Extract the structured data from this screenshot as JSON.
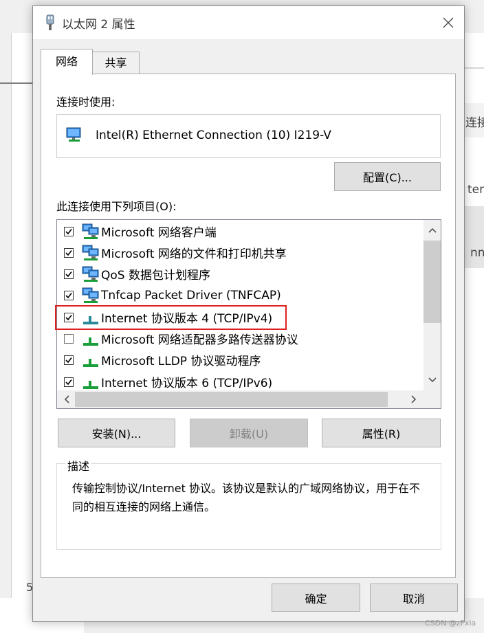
{
  "background": {
    "text_fragments": [
      "连接",
      "ter",
      "nne",
      "5"
    ]
  },
  "dialog": {
    "title": "以太网 2 属性",
    "tabs": [
      {
        "label": "网络",
        "active": true
      },
      {
        "label": "共享",
        "active": false
      }
    ],
    "connect_using_label": "连接时使用:",
    "adapter_name": "Intel(R) Ethernet Connection (10) I219-V",
    "configure_button": "配置(C)...",
    "items_label": "此连接使用下列项目(O):",
    "items": [
      {
        "checked": true,
        "label": "Microsoft 网络客户端",
        "icon": "network-client-icon"
      },
      {
        "checked": true,
        "label": "Microsoft 网络的文件和打印机共享",
        "icon": "file-print-share-icon"
      },
      {
        "checked": true,
        "label": "QoS 数据包计划程序",
        "icon": "qos-icon"
      },
      {
        "checked": true,
        "label": "Tnfcap Packet Driver (TNFCAP)",
        "icon": "packet-driver-icon"
      },
      {
        "checked": true,
        "label": "Internet 协议版本 4 (TCP/IPv4)",
        "icon": "protocol-icon"
      },
      {
        "checked": false,
        "label": "Microsoft 网络适配器多路传送器协议",
        "icon": "protocol-icon"
      },
      {
        "checked": true,
        "label": "Microsoft LLDP 协议驱动程序",
        "icon": "protocol-icon"
      },
      {
        "checked": true,
        "label": "Internet 协议版本 6 (TCP/IPv6)",
        "icon": "protocol-icon"
      }
    ],
    "install_button": "安装(N)...",
    "uninstall_button": "卸载(U)",
    "properties_button": "属性(R)",
    "description_legend": "描述",
    "description_text": "传输控制协议/Internet 协议。该协议是默认的广域网络协议，用于在不同的相互连接的网络上通信。",
    "ok_button": "确定",
    "cancel_button": "取消"
  },
  "watermark": "CSDN @zFxia",
  "colors": {
    "highlight": "#e02020",
    "icon_green": "#1a9e3a",
    "icon_teal": "#2a8a9a",
    "monitor_blue": "#2f7fd0"
  }
}
